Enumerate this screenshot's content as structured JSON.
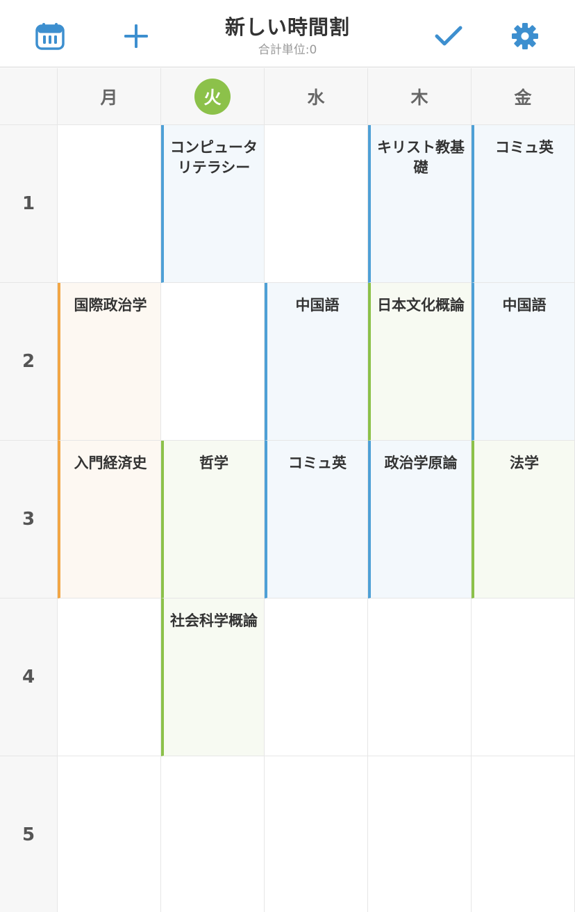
{
  "header": {
    "title": "新しい時間割",
    "subtitle": "合計単位:0",
    "accent_color": "#3d8fcf",
    "icons": {
      "calendar": "calendar-icon",
      "add": "plus-icon",
      "done": "checkmark-icon",
      "settings": "gear-icon"
    }
  },
  "days": [
    {
      "label": "月",
      "today": false
    },
    {
      "label": "火",
      "today": true
    },
    {
      "label": "水",
      "today": false
    },
    {
      "label": "木",
      "today": false
    },
    {
      "label": "金",
      "today": false
    }
  ],
  "periods": [
    "1",
    "2",
    "3",
    "4",
    "5"
  ],
  "colors": {
    "blue": "#4ea0d6",
    "green": "#8cc14a",
    "orange": "#f2a645",
    "today_badge": "#8cc14a"
  },
  "timetable": [
    [
      {
        "text": "",
        "color": ""
      },
      {
        "text": "コンピュータリテラシー",
        "color": "blue"
      },
      {
        "text": "",
        "color": ""
      },
      {
        "text": "キリスト教基礎",
        "color": "blue"
      },
      {
        "text": "コミュ英",
        "color": "blue"
      }
    ],
    [
      {
        "text": "国際政治学",
        "color": "orange"
      },
      {
        "text": "",
        "color": ""
      },
      {
        "text": "中国語",
        "color": "blue"
      },
      {
        "text": "日本文化概論",
        "color": "green"
      },
      {
        "text": "中国語",
        "color": "blue"
      }
    ],
    [
      {
        "text": "入門経済史",
        "color": "orange"
      },
      {
        "text": "哲学",
        "color": "green"
      },
      {
        "text": "コミュ英",
        "color": "blue"
      },
      {
        "text": "政治学原論",
        "color": "blue"
      },
      {
        "text": "法学",
        "color": "green"
      }
    ],
    [
      {
        "text": "",
        "color": ""
      },
      {
        "text": "社会科学概論",
        "color": "green"
      },
      {
        "text": "",
        "color": ""
      },
      {
        "text": "",
        "color": ""
      },
      {
        "text": "",
        "color": ""
      }
    ],
    [
      {
        "text": "",
        "color": ""
      },
      {
        "text": "",
        "color": ""
      },
      {
        "text": "",
        "color": ""
      },
      {
        "text": "",
        "color": ""
      },
      {
        "text": "",
        "color": ""
      }
    ]
  ]
}
